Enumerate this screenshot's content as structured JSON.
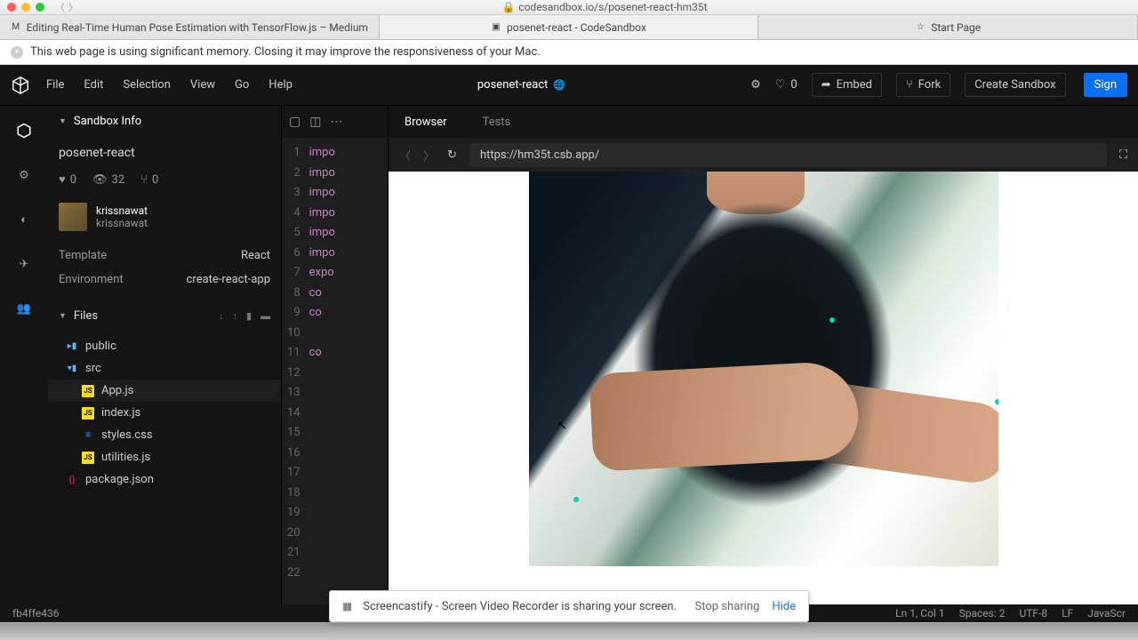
{
  "mac": {
    "url_host": "codesandbox.io/s/posenet-react-hm35t"
  },
  "browser_tabs": [
    {
      "label": "Editing Real-Time Human Pose Estimation with TensorFlow.js – Medium",
      "icon": "M"
    },
    {
      "label": "posenet-react - CodeSandbox",
      "icon": "▣"
    },
    {
      "label": "Start Page",
      "icon": "☆"
    }
  ],
  "warning": "This web page is using significant memory. Closing it may improve the responsiveness of your Mac.",
  "menu": {
    "file": "File",
    "edit": "Edit",
    "selection": "Selection",
    "view": "View",
    "go": "Go",
    "help": "Help"
  },
  "project": {
    "name": "posenet-react"
  },
  "topbar": {
    "likes": "0",
    "embed": "Embed",
    "fork": "Fork",
    "create": "Create Sandbox",
    "sign": "Sign"
  },
  "sidebar": {
    "info_header": "Sandbox Info",
    "title": "posenet-react",
    "stats": {
      "likes": "0",
      "views": "32",
      "forks": "0"
    },
    "user": {
      "display": "krissnawat",
      "handle": "krissnawat"
    },
    "template_label": "Template",
    "template_value": "React",
    "env_label": "Environment",
    "env_value": "create-react-app",
    "files_header": "Files",
    "tree": [
      {
        "name": "public",
        "type": "folder"
      },
      {
        "name": "src",
        "type": "folder-open"
      },
      {
        "name": "App.js",
        "type": "js",
        "indent": true,
        "active": true
      },
      {
        "name": "index.js",
        "type": "js",
        "indent": true
      },
      {
        "name": "styles.css",
        "type": "css",
        "indent": true
      },
      {
        "name": "utilities.js",
        "type": "js",
        "indent": true
      },
      {
        "name": "package.json",
        "type": "json"
      }
    ]
  },
  "editor": {
    "lines": [
      "1",
      "2",
      "3",
      "4",
      "5",
      "6",
      "7",
      "8",
      "9",
      "10",
      "11",
      "12",
      "13",
      "14",
      "15",
      "16",
      "17",
      "18",
      "19",
      "20",
      "21",
      "22"
    ],
    "code": [
      "impo",
      "impo",
      "impo",
      "impo",
      "impo",
      "impo",
      "expo",
      "  co",
      "  co",
      "",
      "  co",
      "",
      "",
      "",
      "",
      "",
      "",
      "",
      "",
      "",
      "",
      ""
    ]
  },
  "preview": {
    "tab_browser": "Browser",
    "tab_tests": "Tests",
    "url": "https://hm35t.csb.app/"
  },
  "share": {
    "text": "Screencastify - Screen Video Recorder is sharing your screen.",
    "stop": "Stop sharing",
    "hide": "Hide"
  },
  "status": {
    "hash": "fb4ffe436",
    "pos": "Ln 1, Col 1",
    "spaces": "Spaces: 2",
    "enc": "UTF-8",
    "eol": "LF",
    "lang": "JavaScr"
  }
}
